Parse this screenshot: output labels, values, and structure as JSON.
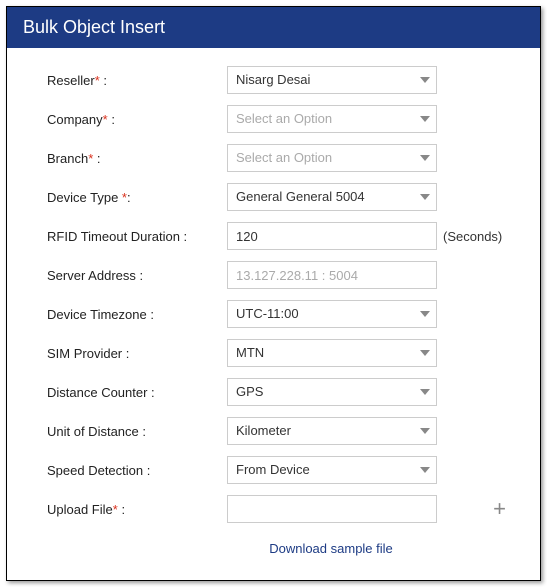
{
  "header": {
    "title": "Bulk Object Insert"
  },
  "fields": {
    "reseller": {
      "label": "Reseller",
      "required": true,
      "value": "Nisarg Desai"
    },
    "company": {
      "label": "Company",
      "required": true,
      "placeholder": "Select an Option"
    },
    "branch": {
      "label": "Branch",
      "required": true,
      "placeholder": "Select an Option"
    },
    "deviceType": {
      "label": "Device Type ",
      "required": true,
      "value": "General General 5004"
    },
    "rfid": {
      "label": "RFID Timeout Duration :",
      "value": "120",
      "suffix": "(Seconds)"
    },
    "server": {
      "label": "Server Address :",
      "value": "13.127.228.11 : 5004"
    },
    "timezone": {
      "label": "Device Timezone :",
      "value": "UTC-11:00"
    },
    "sim": {
      "label": "SIM Provider :",
      "value": "MTN"
    },
    "distance": {
      "label": "Distance Counter :",
      "value": "GPS"
    },
    "unit": {
      "label": "Unit of Distance :",
      "value": "Kilometer"
    },
    "speed": {
      "label": "Speed Detection :",
      "value": "From Device"
    },
    "upload": {
      "label": "Upload File",
      "required": true,
      "value": ""
    }
  },
  "footer": {
    "download_link": "Download sample file"
  }
}
